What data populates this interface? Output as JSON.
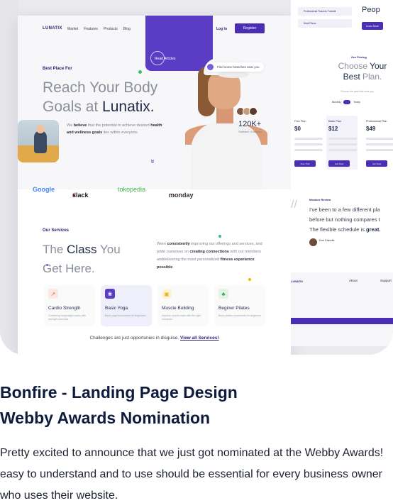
{
  "mockup": {
    "nav": {
      "logo": "LUNATIX",
      "links": [
        "Market",
        "Features",
        "Products",
        "Blog"
      ],
      "login": "Log In",
      "register": "Register"
    },
    "read_articles": "Read Articles",
    "hero": {
      "eyebrow": "Best Place For",
      "title_line1": "Reach Your Body",
      "title_line2_plain": "Goals at ",
      "title_line2_strong": "Lunatix.",
      "sub_pre": "We ",
      "sub_b1": "believe",
      "sub_mid": " that the potential to achieve desired ",
      "sub_b2": "health and wellness goals",
      "sub_post": " lies within everyone.",
      "branch_pill": "Find some branches near you",
      "stat_value": "120K+",
      "stat_label": "Satisfied Customer"
    },
    "logos": [
      "Google",
      "slack",
      "tokopedia",
      "monday"
    ],
    "services": {
      "eyebrow": "Our Services",
      "title_plain1": "The ",
      "title_strong": "Class",
      "title_plain2": " You",
      "title_line2": "Get Here.",
      "desc_pre": "Were ",
      "desc_b1": "consistently",
      "desc_mid1": " improving our offerings and services, and pride ourselves on ",
      "desc_b2": "creating connections",
      "desc_mid2": " with our members anddelivering the most personalized ",
      "desc_b3": "fitness experience possible",
      "desc_post": ".",
      "cards": [
        {
          "title": "Cardio Strength",
          "text": "Combining bodyweight cardio with strength exercises"
        },
        {
          "title": "Basic Yoga",
          "text": "Basic yoga movements for beginners"
        },
        {
          "title": "Muscle Building",
          "text": "Improve muscle mass with the right exercises"
        },
        {
          "title": "Beginer Pilates",
          "text": "Basic pilates movements for beginners"
        }
      ],
      "footer_text": "Challenges are just opportunies in disguise. ",
      "footer_link": "View all Services!"
    }
  },
  "mockup2": {
    "field1": "Professional Trainers Tutorial",
    "field2": "Meal Plans",
    "people": "Peop",
    "learn_more": "Learn More",
    "pricing_eyebrow": "Our Pricing",
    "pricing_title_plain": "Choose ",
    "pricing_title_strong": "Your Best",
    "pricing_title_plain2": " Plan.",
    "pricing_sub": "Choose the plan that suits you",
    "toggle_monthly": "Monthly",
    "toggle_yearly": "Yearly",
    "plans": [
      {
        "name": "Free Plan",
        "price": "$0",
        "button": "Free Trial"
      },
      {
        "name": "Basic Plan",
        "price": "$12",
        "button": "Join Now"
      },
      {
        "name": "Professional Plan",
        "price": "$49",
        "button": "Join Now"
      }
    ],
    "review_eyebrow": "Member Review",
    "review_line1": "I've been to a few different pla",
    "review_line2": "before but nothing compares t",
    "review_line3_plain": "The flexible schedule is ",
    "review_line3_strong": "great.",
    "reviewer": "Emi Fakuda",
    "footer_logo": "LUNATIX",
    "footer_col1": "About",
    "footer_col2": "Support"
  },
  "caption": {
    "title_line1": "Bonfire - Landing Page Design",
    "title_line2": "Webby Awards Nomination",
    "body": "Pretty excited to announce that we just got nominated at the Webby Awards! easy to understand and to use should be essential for every business owner who uses their website."
  },
  "colors": {
    "brand_purple": "#4a2fb5",
    "accent_purple": "#5b3cc4",
    "heading_navy": "#0f1b3c",
    "google_blue": "#4285f4",
    "slack_dark": "#1d1c1d",
    "tokopedia_green": "#42b549",
    "monday_dark": "#333333"
  }
}
